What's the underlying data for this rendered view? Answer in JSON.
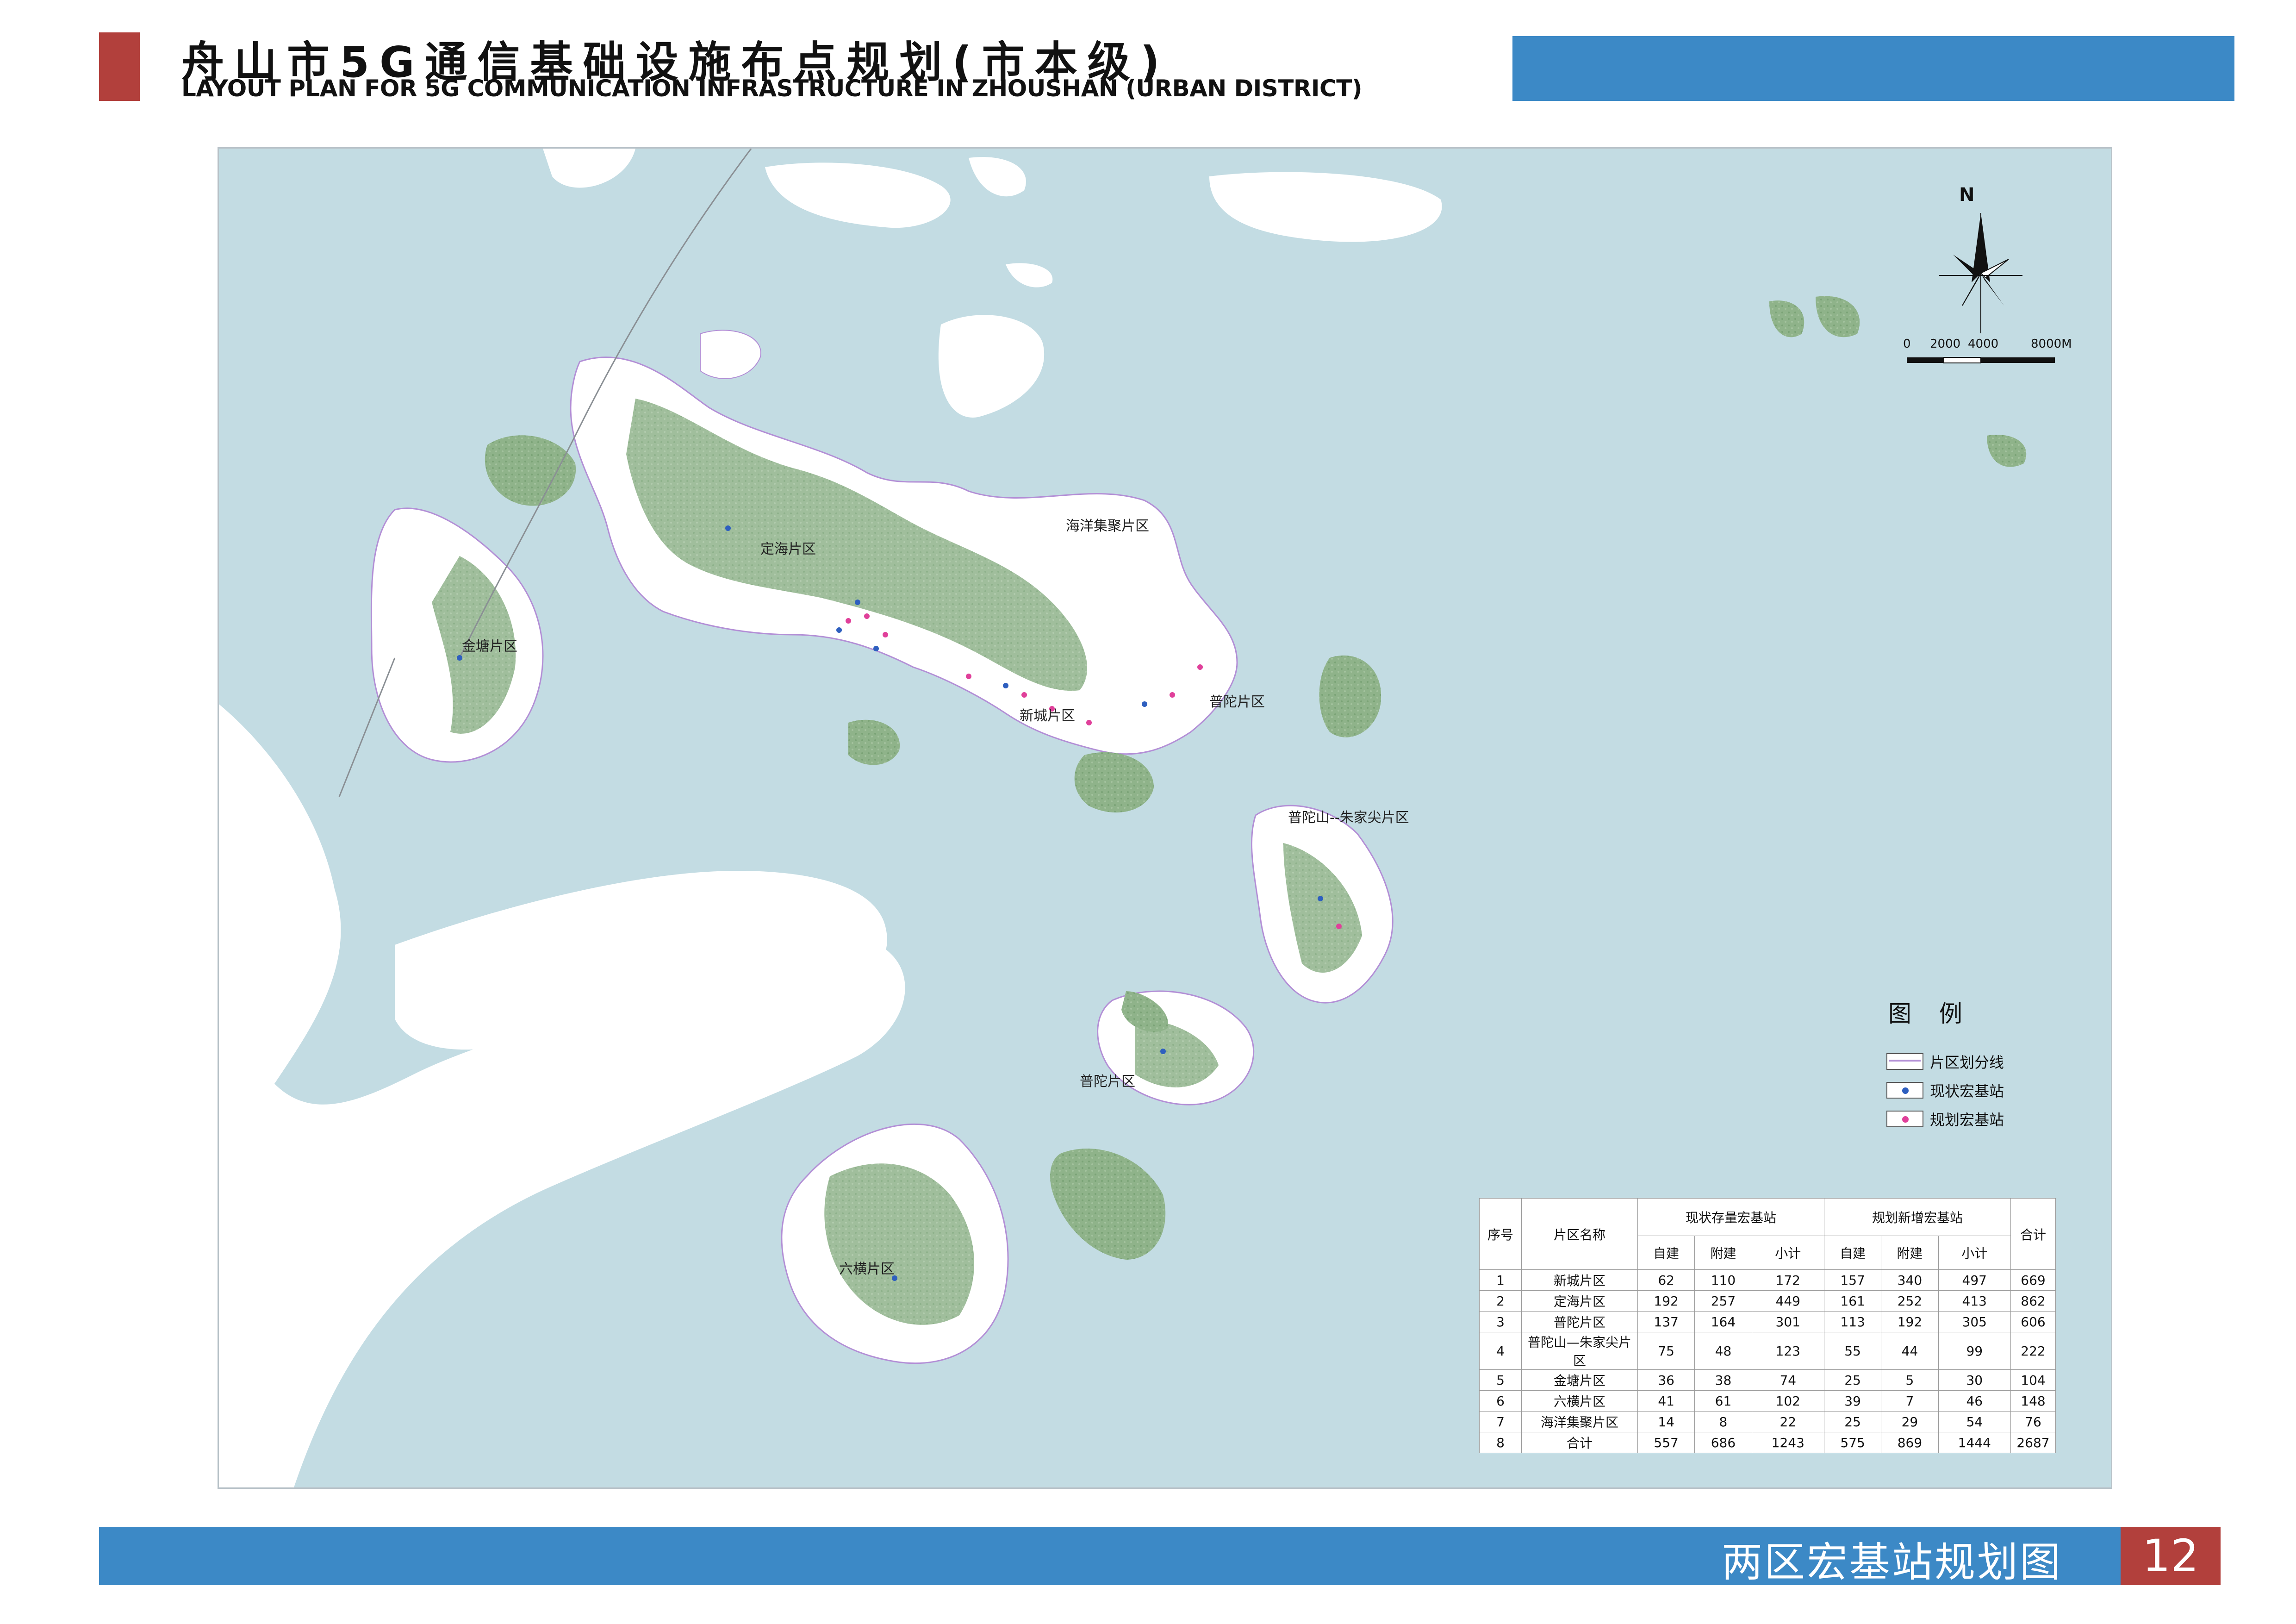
{
  "header": {
    "title_zh": "舟山市5G通信基础设施布点规划(市本级)",
    "title_en": "LAYOUT PLAN FOR 5G COMMUNICATION INFRASTRUCTURE IN ZHOUSHAN (URBAN DISTRICT)"
  },
  "map": {
    "north_label": "N",
    "scale_labels": [
      "0",
      "2000",
      "4000",
      "8000M"
    ],
    "district_labels": {
      "dinghai": "定海片区",
      "haiyang": "海洋集聚片区",
      "jintang": "金塘片区",
      "xincheng": "新城片区",
      "putuo_east": "普陀片区",
      "putuoshan": "普陀山--朱家尖片区",
      "putuo_south": "普陀片区",
      "liuheng": "六横片区"
    }
  },
  "legend": {
    "title": "图例",
    "items": [
      {
        "label": "片区划分线",
        "kind": "boundary",
        "color": "#b38fd6"
      },
      {
        "label": "现状宏基站",
        "kind": "dot",
        "color": "#2e5fbf"
      },
      {
        "label": "规划宏基站",
        "kind": "dot",
        "color": "#e0409a"
      }
    ]
  },
  "table": {
    "headers": {
      "no": "序号",
      "name": "片区名称",
      "existing": "现状存量宏基站",
      "planned": "规划新增宏基站",
      "total": "合计",
      "sub": [
        "自建",
        "附建",
        "小计",
        "自建",
        "附建",
        "小计"
      ]
    },
    "rows": [
      [
        "1",
        "新城片区",
        "62",
        "110",
        "172",
        "157",
        "340",
        "497",
        "669"
      ],
      [
        "2",
        "定海片区",
        "192",
        "257",
        "449",
        "161",
        "252",
        "413",
        "862"
      ],
      [
        "3",
        "普陀片区",
        "137",
        "164",
        "301",
        "113",
        "192",
        "305",
        "606"
      ],
      [
        "4",
        "普陀山—朱家尖片区",
        "75",
        "48",
        "123",
        "55",
        "44",
        "99",
        "222"
      ],
      [
        "5",
        "金塘片区",
        "36",
        "38",
        "74",
        "25",
        "5",
        "30",
        "104"
      ],
      [
        "6",
        "六横片区",
        "41",
        "61",
        "102",
        "39",
        "7",
        "46",
        "148"
      ],
      [
        "7",
        "海洋集聚片区",
        "14",
        "8",
        "22",
        "25",
        "29",
        "54",
        "76"
      ],
      [
        "8",
        "合计",
        "557",
        "686",
        "1243",
        "575",
        "869",
        "1444",
        "2687"
      ]
    ]
  },
  "footer": {
    "title": "两区宏基站规划图",
    "page": "12"
  },
  "colors": {
    "accent_red": "#b2403c",
    "accent_blue": "#3c89c6",
    "sea": "#c3dce3",
    "land": "#ffffff",
    "vegetation": "#8fb38a"
  }
}
